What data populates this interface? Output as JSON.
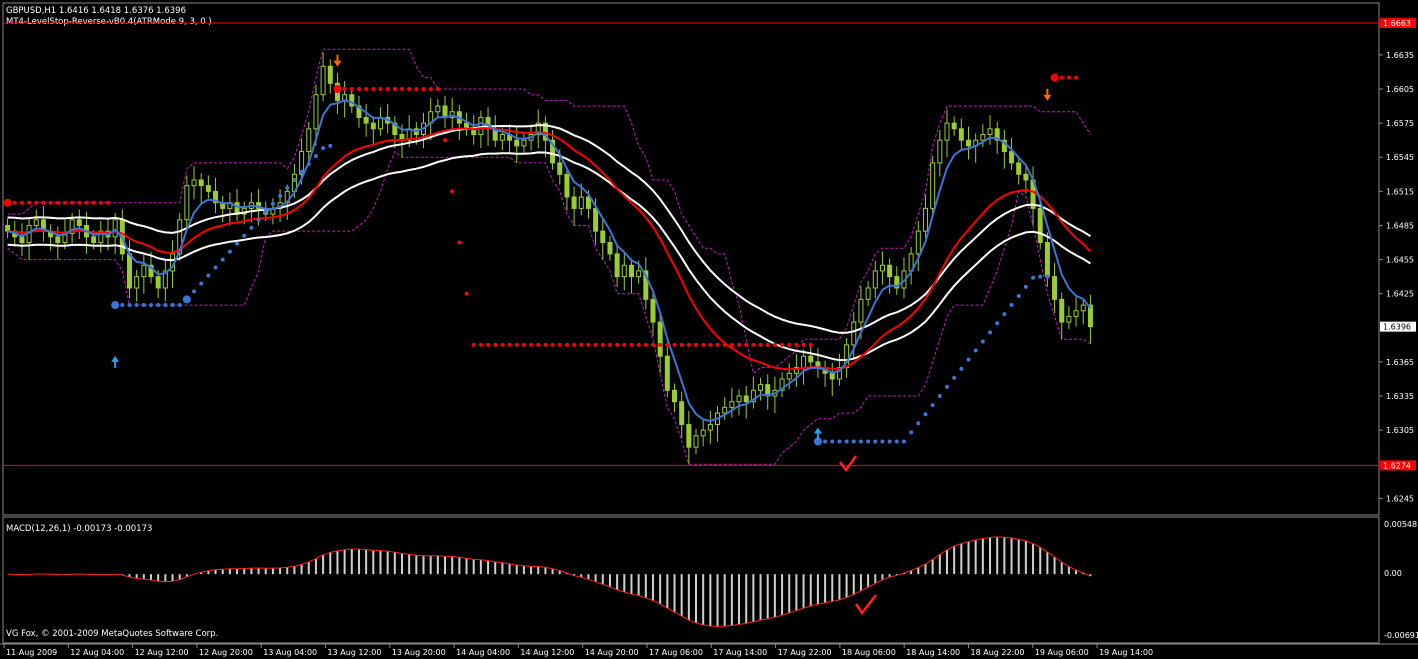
{
  "header": {
    "symbol_line": "GBPUSD,H1  1.6416 1.6418 1.6376 1.6396",
    "indicator_line": "MT4-LevelStop-Reverse-vB0.4(ATRMode 9, 3, 0 )"
  },
  "macd": {
    "label": "MACD(12,26,1) -0.00173 -0.00173",
    "ticks": [
      "0.00548",
      "0.00",
      "-0.00691"
    ]
  },
  "copyright": "VG Fox, © 2001-2009 MetaQuotes Software Corp.",
  "colors": {
    "background": "#000000",
    "bull_candle": "#9acd32",
    "bear_candle": "#9acd32",
    "fast_ma": "#3a76d8",
    "mid_ma": "#ff0000",
    "slow_ma": "#ffffff",
    "level_line": "#ff0000",
    "stop_up": "#3a76d8",
    "stop_down": "#ff0000",
    "bands": "#c020c0"
  },
  "chart_data": {
    "type": "candlestick",
    "symbol": "GBPUSD",
    "timeframe": "H1",
    "ohlc_last": {
      "open": 1.6416,
      "high": 1.6418,
      "low": 1.6376,
      "close": 1.6396
    },
    "y_ticks": [
      "1.6663",
      "1.6635",
      "1.6605",
      "1.6575",
      "1.6545",
      "1.6515",
      "1.6485",
      "1.6455",
      "1.6425",
      "1.6396",
      "1.6365",
      "1.6335",
      "1.6305",
      "1.6274",
      "1.6245"
    ],
    "ylim": [
      1.6233,
      1.6678
    ],
    "x_ticks": [
      "11 Aug 2009",
      "12 Aug 04:00",
      "12 Aug 12:00",
      "12 Aug 20:00",
      "13 Aug 04:00",
      "13 Aug 12:00",
      "13 Aug 20:00",
      "14 Aug 04:00",
      "14 Aug 12:00",
      "14 Aug 20:00",
      "17 Aug 06:00",
      "17 Aug 14:00",
      "17 Aug 22:00",
      "18 Aug 06:00",
      "18 Aug 14:00",
      "18 Aug 22:00",
      "19 Aug 06:00",
      "19 Aug 14:00"
    ],
    "horizontal_levels": [
      {
        "value": 1.6663,
        "label": "1.6663"
      },
      {
        "value": 1.6274,
        "label": "1.6274"
      }
    ],
    "current_price_label": "1.6396",
    "series": [
      {
        "name": "close",
        "values": [
          1.648,
          1.6475,
          1.647,
          1.6485,
          1.649,
          1.648,
          1.6475,
          1.647,
          1.6478,
          1.649,
          1.6485,
          1.6475,
          1.647,
          1.648,
          1.6475,
          1.649,
          1.646,
          1.643,
          1.644,
          1.645,
          1.644,
          1.643,
          1.6445,
          1.646,
          1.649,
          1.652,
          1.6525,
          1.652,
          1.6515,
          1.6505,
          1.65,
          1.6505,
          1.6495,
          1.65,
          1.6505,
          1.65,
          1.6495,
          1.65,
          1.6505,
          1.6515,
          1.653,
          1.655,
          1.657,
          1.66,
          1.6625,
          1.661,
          1.6595,
          1.66,
          1.659,
          1.658,
          1.6575,
          1.657,
          1.658,
          1.6575,
          1.6565,
          1.656,
          1.657,
          1.6565,
          1.6575,
          1.6585,
          1.659,
          1.658,
          1.6585,
          1.6575,
          1.657,
          1.6565,
          1.658,
          1.657,
          1.656,
          1.6565,
          1.656,
          1.6555,
          1.656,
          1.6565,
          1.6575,
          1.656,
          1.654,
          1.653,
          1.651,
          1.65,
          1.651,
          1.65,
          1.648,
          1.647,
          1.646,
          1.644,
          1.645,
          1.644,
          1.6445,
          1.642,
          1.64,
          1.637,
          1.634,
          1.633,
          1.631,
          1.629,
          1.63,
          1.6305,
          1.631,
          1.632,
          1.6325,
          1.633,
          1.6335,
          1.633,
          1.634,
          1.6345,
          1.6335,
          1.634,
          1.635,
          1.6355,
          1.636,
          1.637,
          1.6365,
          1.636,
          1.6355,
          1.635,
          1.636,
          1.638,
          1.64,
          1.642,
          1.643,
          1.6445,
          1.645,
          1.644,
          1.643,
          1.6445,
          1.646,
          1.648,
          1.65,
          1.654,
          1.656,
          1.6575,
          1.657,
          1.656,
          1.6555,
          1.656,
          1.6565,
          1.657,
          1.656,
          1.655,
          1.654,
          1.653,
          1.6525,
          1.65,
          1.647,
          1.644,
          1.642,
          1.64,
          1.6405,
          1.641,
          1.6415,
          1.6396
        ]
      }
    ],
    "macd": {
      "title": "MACD(12,26,1) -0.00173 -0.00173",
      "ylim": [
        -0.00691,
        0.00548
      ]
    }
  }
}
